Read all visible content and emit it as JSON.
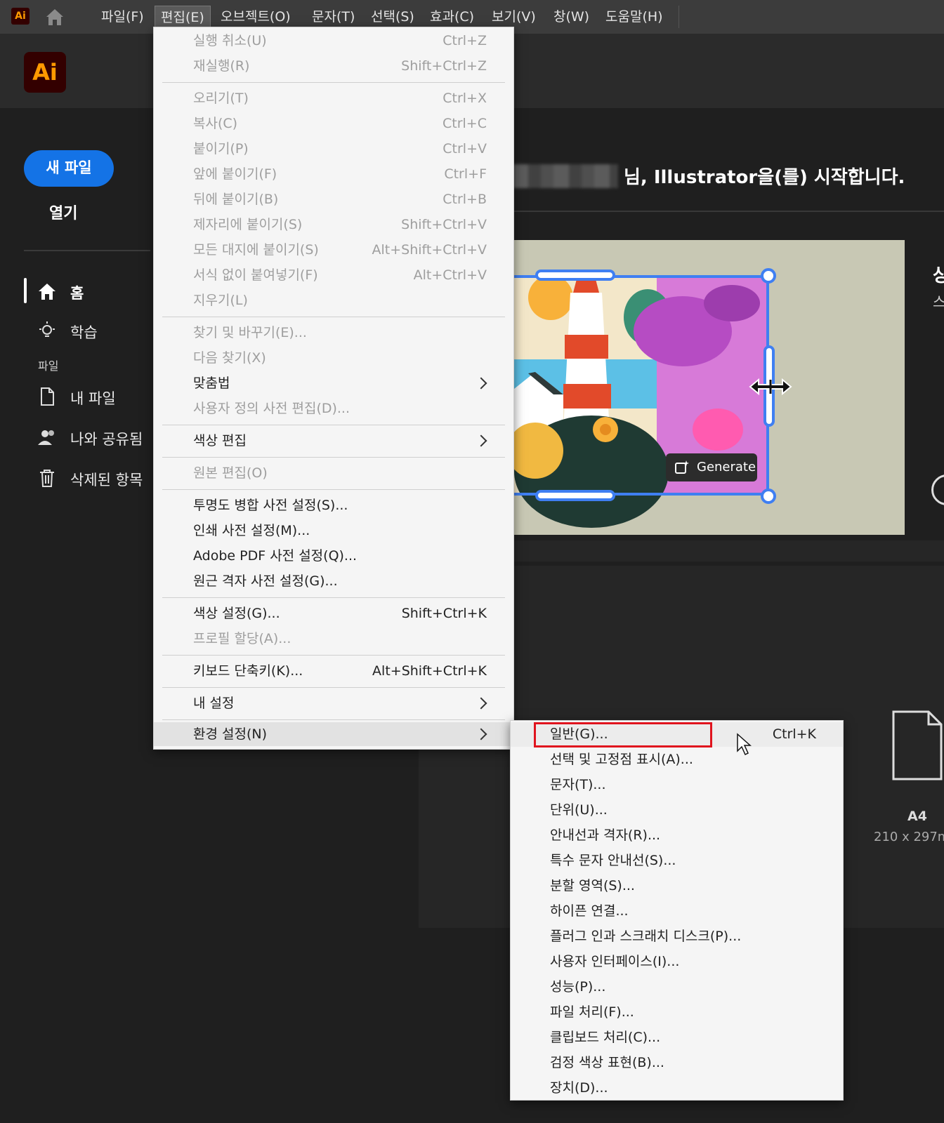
{
  "app": {
    "small_logo": "Ai",
    "logo": "Ai"
  },
  "menubar": [
    "파일(F)",
    "편집(E)",
    "오브젝트(O)",
    "문자(T)",
    "선택(S)",
    "효과(C)",
    "보기(V)",
    "창(W)",
    "도움말(H)"
  ],
  "sidebar": {
    "new_file": "새 파일",
    "open": "열기",
    "home": "홈",
    "learn": "학습",
    "files_section": "파일",
    "my_files": "내 파일",
    "shared": "나와 공유됨",
    "deleted": "삭제된 항목"
  },
  "welcome": {
    "text": "님, Illustrator을(를) 시작합니다."
  },
  "hero": {
    "generate": "Generate",
    "right_text": "상",
    "right_sub": "스"
  },
  "a4": {
    "label": "A4",
    "size": "210 x 297m"
  },
  "edit_menu": [
    {
      "label": "실행 취소(U)",
      "shortcut": "Ctrl+Z",
      "disabled": true
    },
    {
      "label": "재실행(R)",
      "shortcut": "Shift+Ctrl+Z",
      "disabled": true
    },
    {
      "label": "오리기(T)",
      "shortcut": "Ctrl+X",
      "disabled": true
    },
    {
      "label": "복사(C)",
      "shortcut": "Ctrl+C",
      "disabled": true
    },
    {
      "label": "붙이기(P)",
      "shortcut": "Ctrl+V",
      "disabled": true
    },
    {
      "label": "앞에 붙이기(F)",
      "shortcut": "Ctrl+F",
      "disabled": true
    },
    {
      "label": "뒤에 붙이기(B)",
      "shortcut": "Ctrl+B",
      "disabled": true
    },
    {
      "label": "제자리에 붙이기(S)",
      "shortcut": "Shift+Ctrl+V",
      "disabled": true
    },
    {
      "label": "모든 대지에 붙이기(S)",
      "shortcut": "Alt+Shift+Ctrl+V",
      "disabled": true
    },
    {
      "label": "서식 없이 붙여넣기(F)",
      "shortcut": "Alt+Ctrl+V",
      "disabled": true
    },
    {
      "label": "지우기(L)",
      "shortcut": "",
      "disabled": true
    },
    {
      "label": "찾기 및 바꾸기(E)...",
      "shortcut": "",
      "disabled": true
    },
    {
      "label": "다음 찾기(X)",
      "shortcut": "",
      "disabled": true
    },
    {
      "label": "맞춤법",
      "shortcut": "",
      "disabled": false,
      "submenu": true
    },
    {
      "label": "사용자 정의 사전 편집(D)...",
      "shortcut": "",
      "disabled": true
    },
    {
      "label": "색상 편집",
      "shortcut": "",
      "disabled": false,
      "submenu": true
    },
    {
      "label": "원본 편집(O)",
      "shortcut": "",
      "disabled": true
    },
    {
      "label": "투명도 병합 사전 설정(S)...",
      "shortcut": "",
      "disabled": false
    },
    {
      "label": "인쇄 사전 설정(M)...",
      "shortcut": "",
      "disabled": false
    },
    {
      "label": "Adobe PDF 사전 설정(Q)...",
      "shortcut": "",
      "disabled": false
    },
    {
      "label": "원근 격자 사전 설정(G)...",
      "shortcut": "",
      "disabled": false
    },
    {
      "label": "색상 설정(G)...",
      "shortcut": "Shift+Ctrl+K",
      "disabled": false
    },
    {
      "label": "프로필 할당(A)...",
      "shortcut": "",
      "disabled": true
    },
    {
      "label": "키보드 단축키(K)...",
      "shortcut": "Alt+Shift+Ctrl+K",
      "disabled": false
    },
    {
      "label": "내 설정",
      "shortcut": "",
      "disabled": false,
      "submenu": true
    },
    {
      "label": "환경 설정(N)",
      "shortcut": "",
      "disabled": false,
      "submenu": true,
      "highlighted": true
    }
  ],
  "preferences_submenu": [
    {
      "label": "일반(G)...",
      "shortcut": "Ctrl+K"
    },
    {
      "label": "선택 및 고정점 표시(A)...",
      "shortcut": ""
    },
    {
      "label": "문자(T)...",
      "shortcut": ""
    },
    {
      "label": "단위(U)...",
      "shortcut": ""
    },
    {
      "label": "안내선과 격자(R)...",
      "shortcut": ""
    },
    {
      "label": "특수 문자 안내선(S)...",
      "shortcut": ""
    },
    {
      "label": "분할 영역(S)...",
      "shortcut": ""
    },
    {
      "label": "하이픈 연결...",
      "shortcut": ""
    },
    {
      "label": "플러그 인과 스크래치 디스크(P)...",
      "shortcut": ""
    },
    {
      "label": "사용자 인터페이스(I)...",
      "shortcut": ""
    },
    {
      "label": "성능(P)...",
      "shortcut": ""
    },
    {
      "label": "파일 처리(F)...",
      "shortcut": ""
    },
    {
      "label": "클립보드 처리(C)...",
      "shortcut": ""
    },
    {
      "label": "검정 색상 표현(B)...",
      "shortcut": ""
    },
    {
      "label": "장치(D)...",
      "shortcut": ""
    }
  ],
  "colors": {
    "accent": "#1473e6",
    "highlight_box": "#e0141e",
    "menu_bg": "#f5f5f5"
  }
}
